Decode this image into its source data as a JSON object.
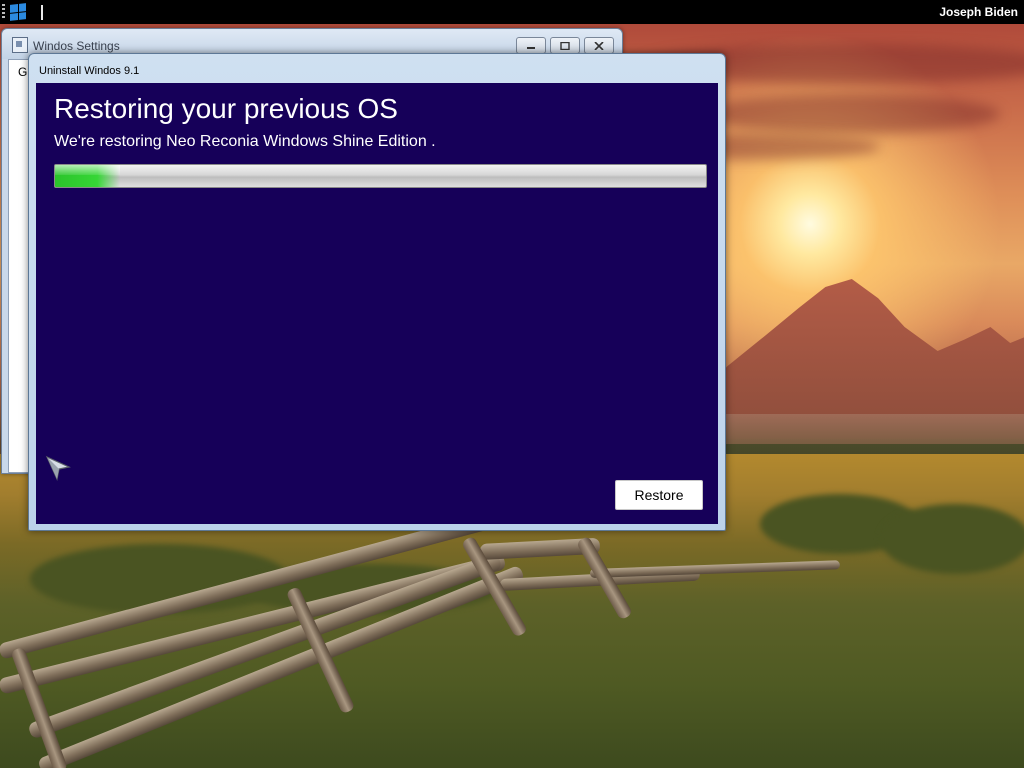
{
  "taskbar": {
    "start_icon": "windows-logo-icon",
    "user_name": "Joseph Biden"
  },
  "settings_window": {
    "title": "Windos Settings",
    "body_text_fragment": "G",
    "controls": {
      "minimize": "minimize-icon",
      "maximize": "maximize-icon",
      "close": "close-icon"
    }
  },
  "uninstall_window": {
    "title": "Uninstall Windos 9.1",
    "heading": "Restoring your previous OS",
    "subtitle": "We're restoring Neo Reconia Windows Shine Edition .",
    "progress_fraction": 0.1,
    "restore_label": "Restore"
  },
  "colors": {
    "dialog_background": "#160059",
    "progress_green": "#36d636",
    "taskbar": "#000000"
  },
  "pointer": "arrow-cursor-icon"
}
